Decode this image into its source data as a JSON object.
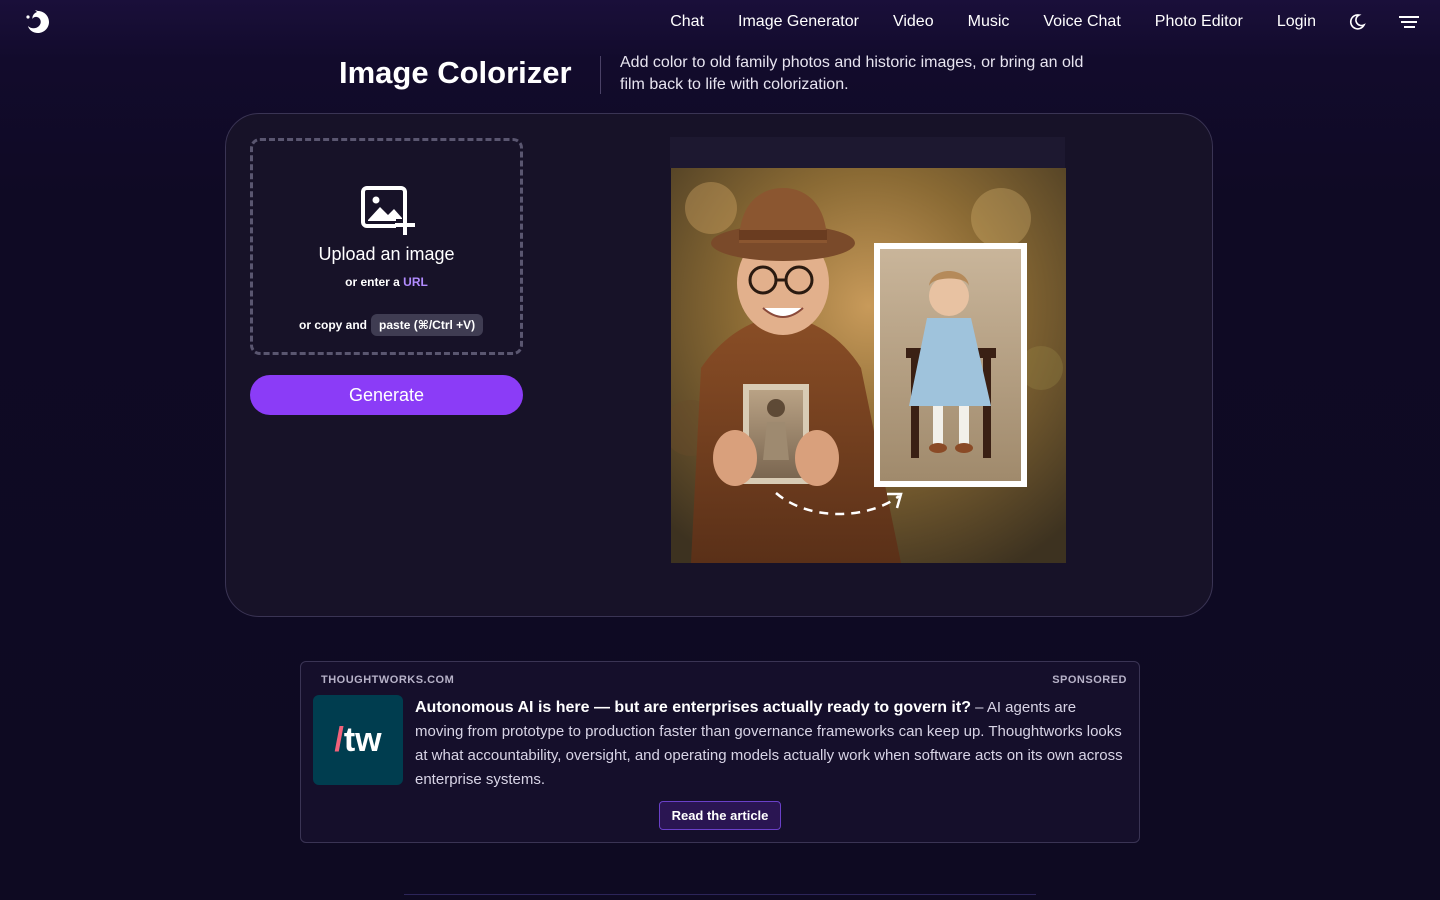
{
  "nav": {
    "items": [
      "Chat",
      "Image Generator",
      "Video",
      "Music",
      "Voice Chat",
      "Photo Editor",
      "Login"
    ],
    "theme_icon": "moon-icon",
    "menu_icon": "hamburger-menu-icon"
  },
  "page": {
    "title": "Image Colorizer",
    "description": "Add color to old family photos and historic images, or bring an old film back to life with colorization."
  },
  "upload": {
    "icon": "image-add-icon",
    "title": "Upload an image",
    "url_prefix": "or enter a",
    "url_link": "URL",
    "paste_prefix": "or copy and",
    "paste_chip": "paste (⌘/Ctrl +V)"
  },
  "generate_label": "Generate",
  "ad": {
    "source": "THOUGHTWORKS.COM",
    "sponsored": "SPONSORED",
    "logo_text": "tw",
    "headline": "Autonomous AI is here — but are enterprises actually ready to govern it?",
    "body": " – AI agents are moving from prototype to production faster than governance frameworks can keep up. Thoughtworks looks at what accountability, oversight, and operating models actually work when software acts on its own across enterprise systems.",
    "cta": "Read the article"
  },
  "colors": {
    "accent": "#8b3cf7",
    "link": "#b28cff",
    "background": "#100a24",
    "card": "#171228"
  }
}
